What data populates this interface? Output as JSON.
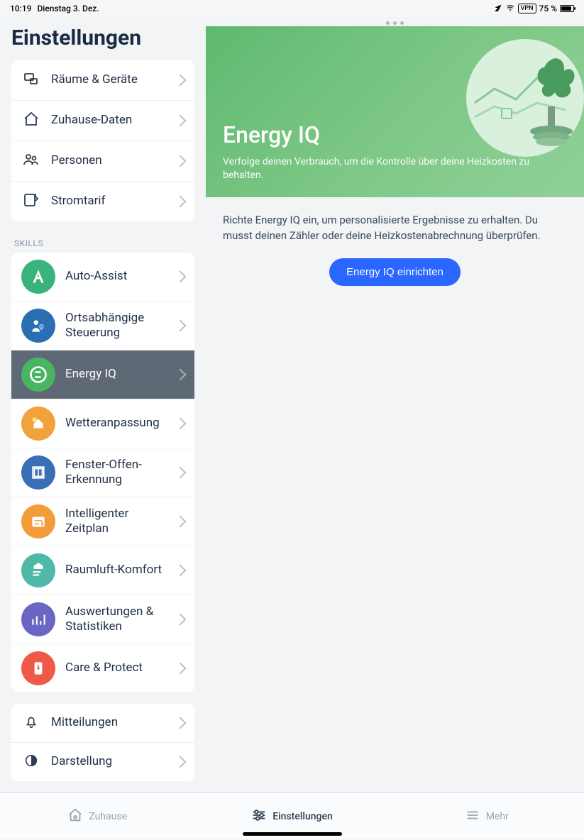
{
  "status": {
    "time": "10:19",
    "date": "Dienstag 3. Dez.",
    "vpn": "VPN",
    "battery_pct": "75 %"
  },
  "sidebar": {
    "title": "Einstellungen",
    "section1": [
      {
        "label": "Räume & Geräte"
      },
      {
        "label": "Zuhause-Daten"
      },
      {
        "label": "Personen"
      },
      {
        "label": "Stromtarif"
      }
    ],
    "skills_header": "SKILLS",
    "skills": [
      {
        "label": "Auto-Assist",
        "color": "#3ab27b"
      },
      {
        "label": "Ortsabhängige Steuerung",
        "color": "#2b6fb3"
      },
      {
        "label": "Energy IQ",
        "color": "#49b563",
        "active": true
      },
      {
        "label": "Wetteranpassung",
        "color": "#f2a23a"
      },
      {
        "label": "Fenster-Offen-Erkennung",
        "color": "#3a6fb5"
      },
      {
        "label": "Intelligenter Zeitplan",
        "color": "#f29d3a"
      },
      {
        "label": "Raumluft-Komfort",
        "color": "#4fb9a8"
      },
      {
        "label": "Auswertungen & Statistiken",
        "color": "#6b65c4"
      },
      {
        "label": "Care & Protect",
        "color": "#f0594a"
      }
    ],
    "section3": [
      {
        "label": "Mitteilungen"
      },
      {
        "label": "Darstellung"
      }
    ]
  },
  "content": {
    "hero_title": "Energy IQ",
    "hero_sub": "Verfolge deinen Verbrauch, um die Kontrolle über deine Heizkosten zu behalten.",
    "info": "Richte Energy IQ ein, um personalisierte Ergebnisse zu erhalten. Du musst deinen Zähler oder deine Heizkostenabrechnung überprüfen.",
    "cta": "Energy IQ einrichten"
  },
  "tabs": {
    "home": "Zuhause",
    "settings": "Einstellungen",
    "more": "Mehr"
  }
}
